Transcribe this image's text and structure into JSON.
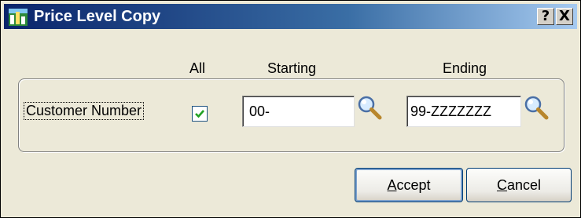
{
  "window": {
    "title": "Price Level Copy",
    "help_label": "?",
    "close_label": "X",
    "app_icon": "M"
  },
  "columns": {
    "all": "All",
    "starting": "Starting",
    "ending": "Ending"
  },
  "row": {
    "label": "Customer Number",
    "all_checked": true,
    "starting_value": "00-",
    "ending_value": "99-ZZZZZZZ"
  },
  "buttons": {
    "accept_mnemonic": "A",
    "accept_rest": "ccept",
    "cancel_mnemonic": "C",
    "cancel_rest": "ancel"
  },
  "icons": {
    "app": "mas90-app-icon",
    "lookup": "magnifier-icon",
    "check": "checkmark-icon"
  },
  "colors": {
    "titlebar_start": "#0a246a",
    "titlebar_end": "#a6caf0",
    "dialog_bg": "#ece9d8",
    "check": "#21a121",
    "accept_focus": "#7da2ce"
  }
}
